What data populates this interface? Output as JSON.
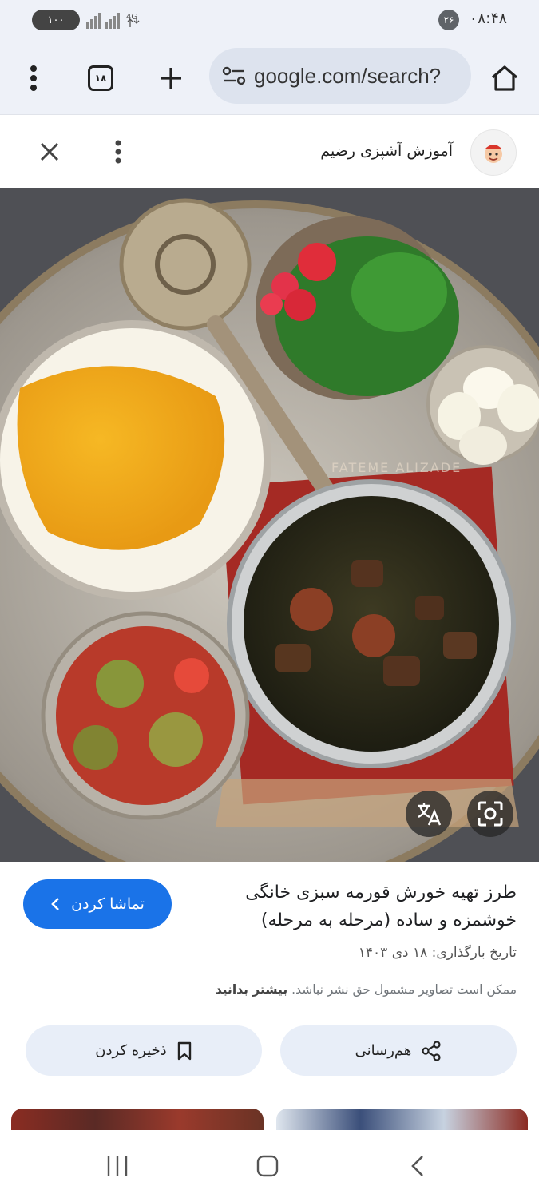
{
  "status_bar": {
    "time": "۰۸:۴۸",
    "notification_count": "۲۶",
    "battery": "۱۰۰",
    "network": "4G"
  },
  "browser": {
    "url": "google.com/search?",
    "tab_count": "۱۸"
  },
  "source": {
    "name": "آموزش آشپزی رضیم"
  },
  "image": {
    "watermark": "FATEME ALIZADE",
    "description_icons": [
      "translate-icon",
      "lens-icon"
    ]
  },
  "result": {
    "title": "طرز تهیه خورش قورمه سبزی خانگی خوشمزه و ساده (مرحله به مرحله)",
    "date": "تاریخ بارگذاری: ۱۸ دی ۱۴۰۳",
    "copyright_text": "ممکن است تصاویر مشمول حق نشر نباشد.",
    "copyright_link": "بیشتر بدانید",
    "watch_label": "تماشا کردن",
    "share_label": "هم‌رسانی",
    "save_label": "ذخیره کردن"
  },
  "colors": {
    "accent": "#1a73e8",
    "toolbar_bg": "#eef1f8",
    "pill_bg": "#e8eef8"
  }
}
